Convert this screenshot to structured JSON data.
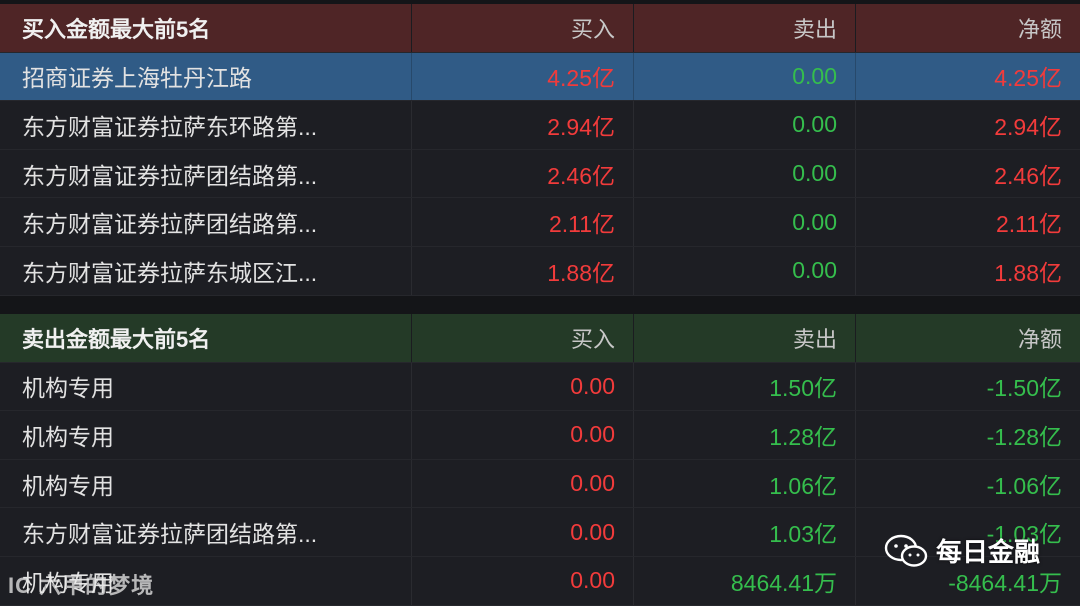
{
  "buy_section": {
    "title": "买入金额最大前5名",
    "col_buy": "买入",
    "col_sell": "卖出",
    "col_net": "净额",
    "rows": [
      {
        "name": "招商证券上海牡丹江路",
        "buy": "4.25亿",
        "sell": "0.00",
        "net": "4.25亿"
      },
      {
        "name": "东方财富证券拉萨东环路第...",
        "buy": "2.94亿",
        "sell": "0.00",
        "net": "2.94亿"
      },
      {
        "name": "东方财富证券拉萨团结路第...",
        "buy": "2.46亿",
        "sell": "0.00",
        "net": "2.46亿"
      },
      {
        "name": "东方财富证券拉萨团结路第...",
        "buy": "2.11亿",
        "sell": "0.00",
        "net": "2.11亿"
      },
      {
        "name": "东方财富证券拉萨东城区江...",
        "buy": "1.88亿",
        "sell": "0.00",
        "net": "1.88亿"
      }
    ]
  },
  "sell_section": {
    "title": "卖出金额最大前5名",
    "col_buy": "买入",
    "col_sell": "卖出",
    "col_net": "净额",
    "rows": [
      {
        "name": "机构专用",
        "buy": "0.00",
        "sell": "1.50亿",
        "net": "-1.50亿"
      },
      {
        "name": "机构专用",
        "buy": "0.00",
        "sell": "1.28亿",
        "net": "-1.28亿"
      },
      {
        "name": "机构专用",
        "buy": "0.00",
        "sell": "1.06亿",
        "net": "-1.06亿"
      },
      {
        "name": "东方财富证券拉萨团结路第...",
        "buy": "0.00",
        "sell": "1.03亿",
        "net": "-1.03亿"
      },
      {
        "name": "机构专用",
        "buy": "0.00",
        "sell": "8464.41万",
        "net": "-8464.41万"
      }
    ]
  },
  "watermark": {
    "label": "每日金融",
    "left_label": "IC 六甲的梦境"
  },
  "colors": {
    "buy_header": "#4f2526",
    "sell_header": "#243a27",
    "selected_row": "#305b86",
    "positive": "#f23b3b",
    "negative": "#35be4d"
  }
}
